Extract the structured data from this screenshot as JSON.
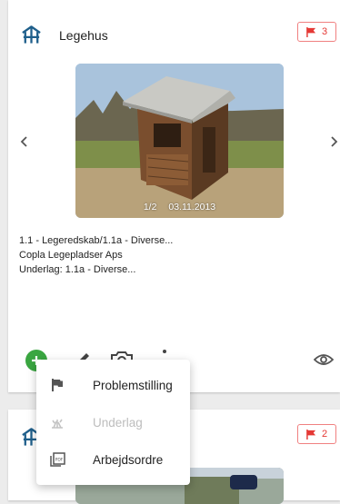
{
  "cards": [
    {
      "title": "Legehus",
      "flag_count": "3",
      "photo": {
        "counter": "1/2",
        "date": "03.11.2013"
      },
      "details": [
        "1.1 - Legeredskab/1.1a - Diverse...",
        "Copla Legepladser Aps",
        "Underlag: 1.1a - Diverse..."
      ]
    },
    {
      "flag_count": "2"
    }
  ],
  "menu": {
    "items": [
      {
        "label": "Problemstilling",
        "icon": "flag-icon",
        "enabled": true
      },
      {
        "label": "Underlag",
        "icon": "ground-icon",
        "enabled": false
      },
      {
        "label": "Arbejdsordre",
        "icon": "pdf-icon",
        "enabled": true
      }
    ]
  },
  "colors": {
    "accent_blue": "#1f5f8b",
    "flag_red": "#e53935",
    "add_green": "#3aa641"
  }
}
